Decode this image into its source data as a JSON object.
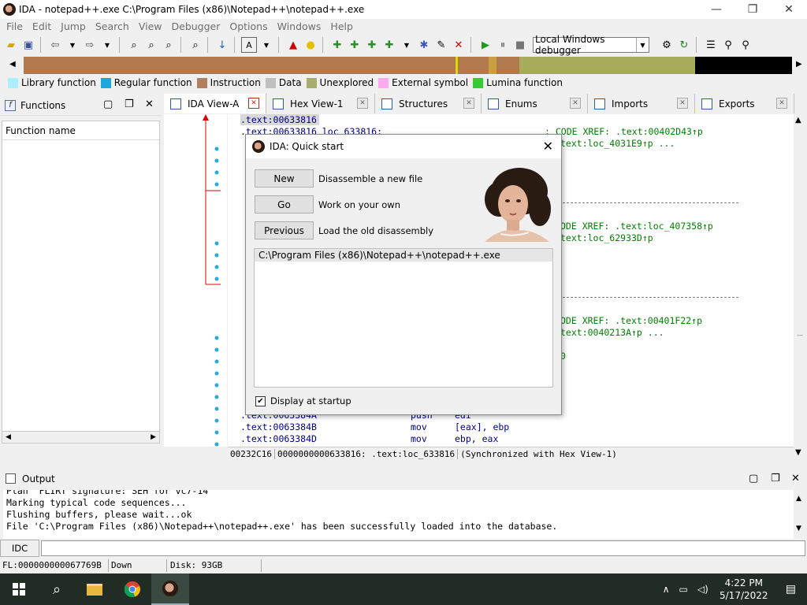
{
  "window": {
    "title": "IDA - notepad++.exe C:\\Program Files (x86)\\Notepad++\\notepad++.exe",
    "minimize": "—",
    "restore": "❐",
    "close": "✕"
  },
  "menu": [
    "File",
    "Edit",
    "Jump",
    "Search",
    "View",
    "Debugger",
    "Options",
    "Windows",
    "Help"
  ],
  "toolbar": {
    "debugger_select": "Local Windows debugger"
  },
  "legend": [
    {
      "label": "Library function",
      "color": "#aaeeff"
    },
    {
      "label": "Regular function",
      "color": "#1ca8dd"
    },
    {
      "label": "Instruction",
      "color": "#b08060"
    },
    {
      "label": "Data",
      "color": "#c0c0c0"
    },
    {
      "label": "Unexplored",
      "color": "#a8ac6c"
    },
    {
      "label": "External symbol",
      "color": "#ffaaee"
    },
    {
      "label": "Lumina function",
      "color": "#33cc33"
    }
  ],
  "functions_panel": {
    "title": "Functions",
    "column": "Function name"
  },
  "tabs": [
    {
      "label": "IDA View-A",
      "active": true
    },
    {
      "label": "Hex View-1"
    },
    {
      "label": "Structures"
    },
    {
      "label": "Enums"
    },
    {
      "label": "Imports"
    },
    {
      "label": "Exports"
    }
  ],
  "disasm": {
    "lines": [
      {
        "text": ".text:00633816",
        "green": ""
      },
      {
        "text": ".text:00633816 loc_633816:",
        "green": "; CODE XREF: .text:00402D43↑p"
      },
      {
        "text": "",
        "green": "text:loc_4031E9↑p ..."
      },
      {
        "text": "",
        "green": "ODE XREF: .text:loc_407358↑p"
      },
      {
        "text": "",
        "green": "text:loc_62933D↑p"
      },
      {
        "text": "",
        "green": "ODE XREF: .text:00401F22↑p"
      },
      {
        "text": "",
        "green": "text:0040213A↑p ..."
      },
      {
        "text": "",
        "green": "0"
      },
      {
        "text": ".text:0063384A",
        "op": "push",
        "args": "edi"
      },
      {
        "text": ".text:0063384B",
        "op": "mov",
        "args": "[eax], ebp"
      },
      {
        "text": ".text:0063384D",
        "op": "mov",
        "args": "ebp, eax"
      }
    ],
    "status": [
      "00232C16",
      "0000000000633816: .text:loc_633816",
      "(Synchronized with Hex View-1)"
    ]
  },
  "quickstart": {
    "title": "IDA: Quick start",
    "buttons": [
      {
        "label": "New",
        "desc": "Disassemble a new file"
      },
      {
        "label": "Go",
        "desc": "Work on your own"
      },
      {
        "label": "Previous",
        "desc": "Load the old disassembly"
      }
    ],
    "recent": [
      "C:\\Program Files (x86)\\Notepad++\\notepad++.exe"
    ],
    "display_at_startup": "Display at startup",
    "checked": true
  },
  "output": {
    "title": "Output",
    "lines": [
      "Plan  FLIRT signature: SEH for vc7-14",
      "Marking typical code sequences...",
      "Flushing buffers, please wait...ok",
      "File 'C:\\Program Files (x86)\\Notepad++\\notepad++.exe' has been successfully loaded into the database."
    ],
    "idc_label": "IDC"
  },
  "statusbar": [
    "FL:000000000067769B",
    "Down",
    "Disk: 93GB"
  ],
  "taskbar": {
    "time": "4:22 PM",
    "date": "5/17/2022"
  }
}
